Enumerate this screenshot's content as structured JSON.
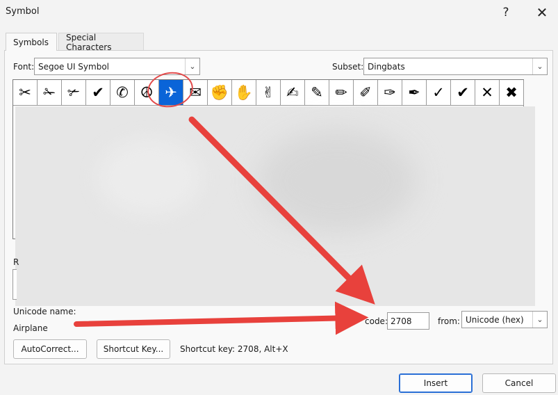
{
  "window": {
    "title": "Symbol",
    "help_glyph": "?",
    "close_glyph": "✕"
  },
  "tabs": [
    {
      "label": "Symbols"
    },
    {
      "label": "Special Characters"
    }
  ],
  "font": {
    "label": "Font:",
    "value": "Segoe UI Symbol"
  },
  "subset": {
    "label": "Subset:",
    "value": "Dingbats"
  },
  "symbols_row": [
    "✂",
    "✁",
    "✃",
    "✔",
    "✆",
    "☮",
    "✈",
    "✉",
    "✊",
    "✋",
    "✌",
    "✍",
    "✎",
    "✏",
    "✐",
    "✑",
    "✒",
    "✓",
    "✔",
    "✕",
    "✖"
  ],
  "selected_index": 6,
  "left_fragments": {
    "recent_initial": "R"
  },
  "unicode_name": {
    "label": "Unicode name:",
    "value": "Airplane"
  },
  "char_code": {
    "label_visible": "code:",
    "value": "2708"
  },
  "from": {
    "label": "from:",
    "value": "Unicode (hex)"
  },
  "buttons": {
    "autocorrect": "AutoCorrect...",
    "shortcut_key": "Shortcut Key...",
    "insert": "Insert",
    "cancel": "Cancel"
  },
  "shortcut_info": "Shortcut key: 2708, Alt+X",
  "colors": {
    "accent": "#0a64d8",
    "annotation": "#e8413c"
  }
}
